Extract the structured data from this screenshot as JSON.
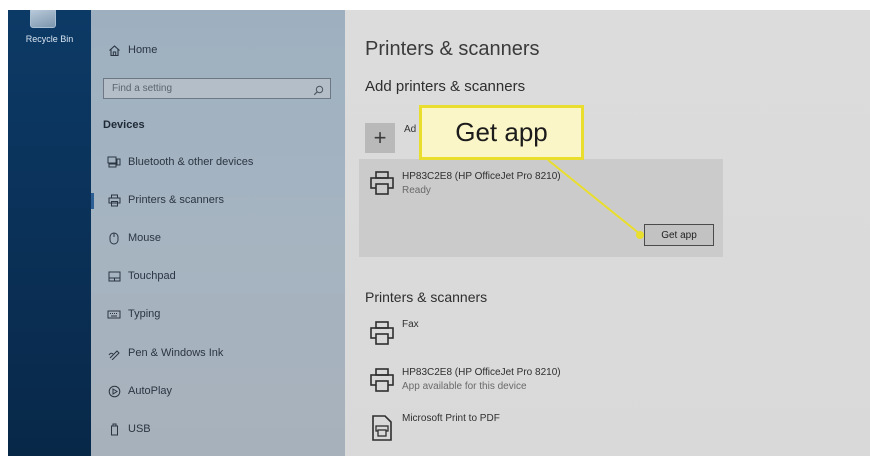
{
  "desktop": {
    "recycle_bin_label": "Recycle Bin"
  },
  "sidebar": {
    "home_label": "Home",
    "search": {
      "placeholder": "Find a setting"
    },
    "section_heading": "Devices",
    "items": [
      {
        "label": "Bluetooth & other devices",
        "icon": "bluetooth-devices-icon",
        "selected": false
      },
      {
        "label": "Printers & scanners",
        "icon": "printer-icon",
        "selected": true
      },
      {
        "label": "Mouse",
        "icon": "mouse-icon",
        "selected": false
      },
      {
        "label": "Touchpad",
        "icon": "touchpad-icon",
        "selected": false
      },
      {
        "label": "Typing",
        "icon": "keyboard-icon",
        "selected": false
      },
      {
        "label": "Pen & Windows Ink",
        "icon": "pen-icon",
        "selected": false
      },
      {
        "label": "AutoPlay",
        "icon": "autoplay-icon",
        "selected": false
      },
      {
        "label": "USB",
        "icon": "usb-icon",
        "selected": false
      }
    ]
  },
  "main": {
    "title": "Printers & scanners",
    "add_section": {
      "heading": "Add printers & scanners",
      "add_button_symbol": "+",
      "add_label_partial": "Ad"
    },
    "found_printer": {
      "name": "HP83C2E8 (HP OfficeJet Pro 8210)",
      "status": "Ready",
      "button_label": "Get app"
    },
    "list_heading": "Printers & scanners",
    "printers": [
      {
        "name": "Fax",
        "status": "",
        "icon": "printer-icon"
      },
      {
        "name": "HP83C2E8 (HP OfficeJet Pro 8210)",
        "status": "App available for this device",
        "icon": "printer-icon"
      },
      {
        "name": "Microsoft Print to PDF",
        "status": "",
        "icon": "pdf-printer-icon"
      }
    ]
  },
  "callout": {
    "text": "Get app",
    "color": "#e9de2d",
    "fill": "#fbf6c7"
  }
}
